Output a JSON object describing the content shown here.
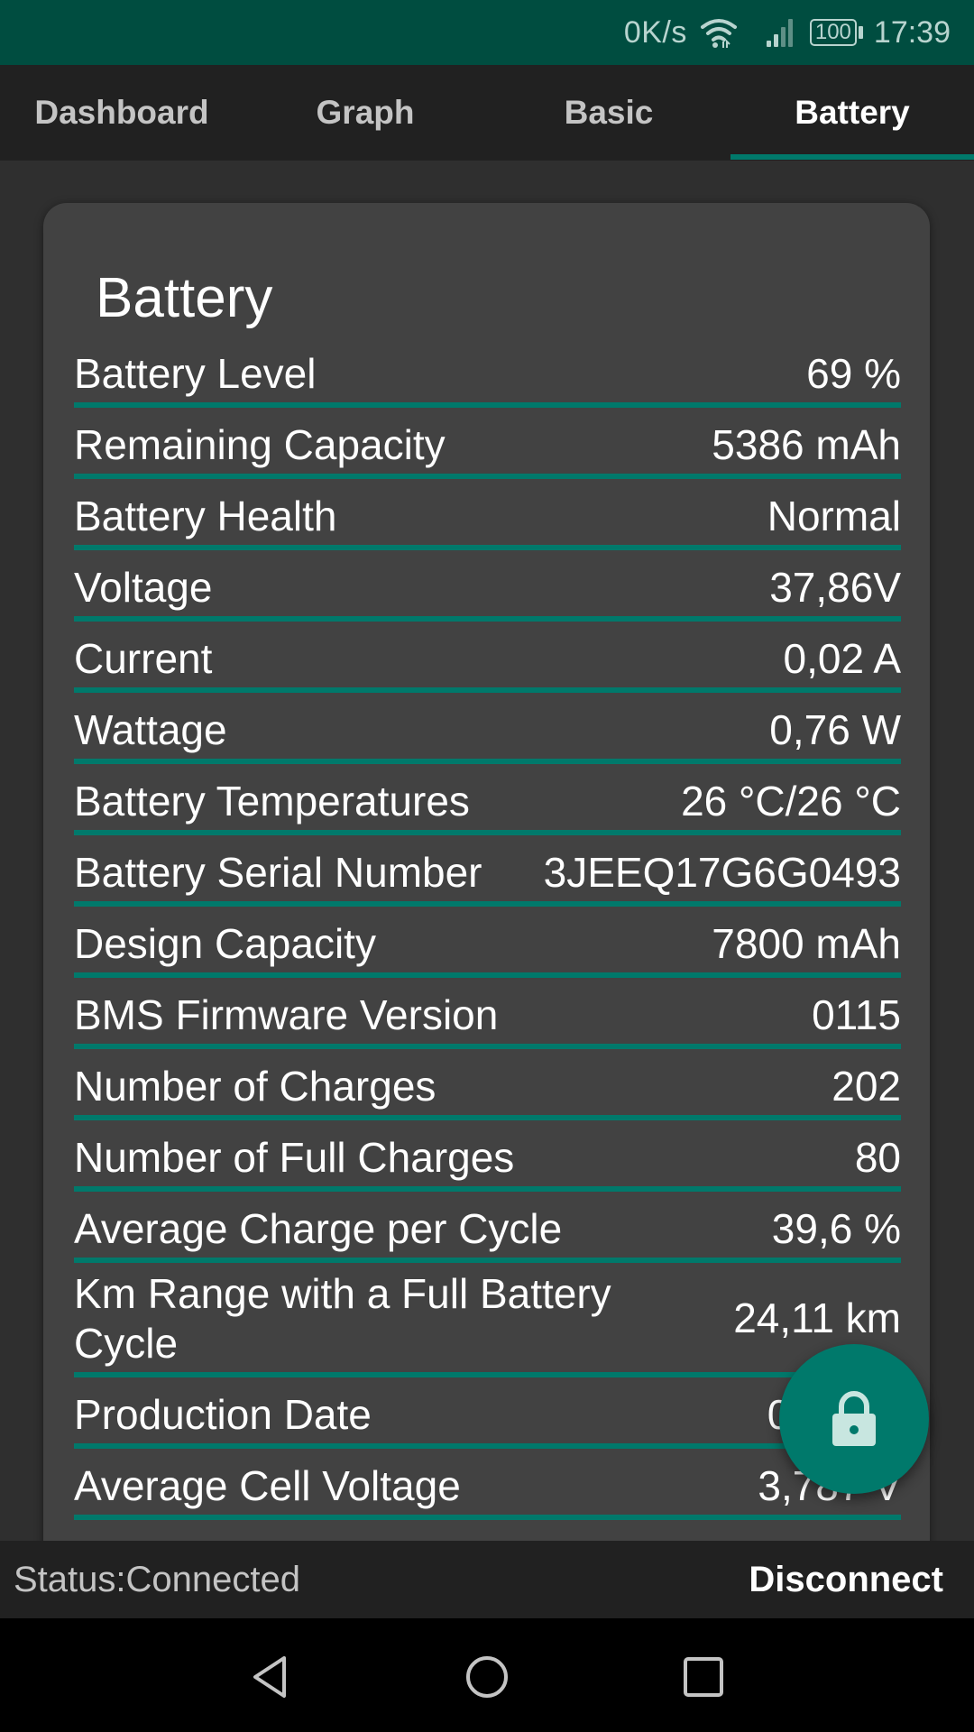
{
  "status_bar": {
    "net_speed": "0K/s",
    "battery_level": "100",
    "time": "17:39",
    "icons": [
      "wifi-icon",
      "signal-icon",
      "battery-icon"
    ]
  },
  "tabs": [
    {
      "label": "Dashboard",
      "active": false
    },
    {
      "label": "Graph",
      "active": false
    },
    {
      "label": "Basic",
      "active": false
    },
    {
      "label": "Battery",
      "active": true
    }
  ],
  "card": {
    "title": "Battery",
    "rows": [
      {
        "label": "Battery Level",
        "value": "69 %"
      },
      {
        "label": "Remaining Capacity",
        "value": "5386 mAh"
      },
      {
        "label": "Battery Health",
        "value": "Normal"
      },
      {
        "label": "Voltage",
        "value": "37,86V"
      },
      {
        "label": "Current",
        "value": "0,02 A"
      },
      {
        "label": "Wattage",
        "value": "0,76 W"
      },
      {
        "label": "Battery Temperatures",
        "value": "26 °C/26 °C"
      },
      {
        "label": "Battery Serial Number",
        "value": "3JEEQ17G6G0493"
      },
      {
        "label": "Design Capacity",
        "value": "7800 mAh"
      },
      {
        "label": "BMS Firmware Version",
        "value": "0115"
      },
      {
        "label": "Number of Charges",
        "value": "202"
      },
      {
        "label": "Number of Full Charges",
        "value": "80"
      },
      {
        "label": "Average Charge per Cycle",
        "value": "39,6 %"
      },
      {
        "label": "Km Range with a Full Battery Cycle",
        "value": "24,11 km"
      },
      {
        "label": "Production Date",
        "value": "06-July"
      },
      {
        "label": "Average Cell Voltage",
        "value": "3,787 V"
      }
    ]
  },
  "fab": {
    "icon": "lock-icon"
  },
  "footer": {
    "status": "Status:Connected",
    "disconnect_label": "Disconnect"
  },
  "nav": {
    "icons": [
      "back-icon",
      "home-icon",
      "recents-icon"
    ]
  },
  "colors": {
    "status_bar": "#004d40",
    "accent": "#00796b",
    "card": "#424242",
    "background": "#2f2f2f",
    "tab_bar": "#212121"
  }
}
